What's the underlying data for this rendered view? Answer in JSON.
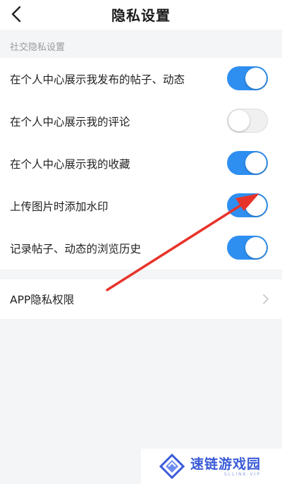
{
  "header": {
    "title": "隐私设置",
    "back_icon": "chevron-left-icon"
  },
  "section": {
    "label": "社交隐私设置"
  },
  "settings": [
    {
      "label": "在个人中心展示我发布的帖子、动态",
      "enabled": true
    },
    {
      "label": "在个人中心展示我的评论",
      "enabled": false
    },
    {
      "label": "在个人中心展示我的收藏",
      "enabled": true
    },
    {
      "label": "上传图片时添加水印",
      "enabled": true
    },
    {
      "label": "记录帖子、动态的浏览历史",
      "enabled": true
    }
  ],
  "app_privacy": {
    "label": "APP隐私权限",
    "icon": "chevron-right-icon"
  },
  "watermark": {
    "name": "速链游戏园",
    "url": "SLLINK.VIP",
    "logo_icon": "diamond-logo-icon"
  },
  "colors": {
    "accent": "#2e8ff0",
    "annotation_arrow": "#e8332a",
    "watermark_brand": "#3a5ad8"
  }
}
